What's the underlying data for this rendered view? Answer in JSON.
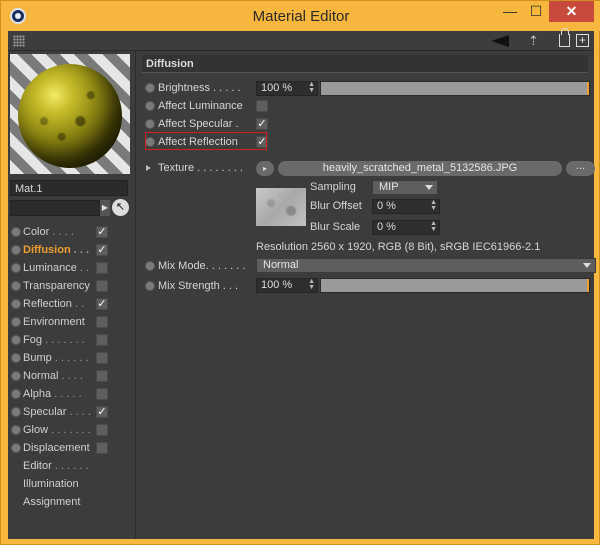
{
  "window": {
    "title": "Material Editor",
    "min_label": "—",
    "max_label": "☐",
    "close_label": "✕"
  },
  "material": {
    "name": "Mat.1"
  },
  "channels": [
    {
      "label": "Color",
      "dots": " . . . .",
      "checked": "✓"
    },
    {
      "label": "Diffusion",
      "dots": " . . .",
      "checked": "✓"
    },
    {
      "label": "Luminance",
      "dots": " . .",
      "checked": ""
    },
    {
      "label": "Transparency",
      "dots": "",
      "checked": ""
    },
    {
      "label": "Reflection",
      "dots": " . .",
      "checked": "✓"
    },
    {
      "label": "Environment",
      "dots": "",
      "checked": ""
    },
    {
      "label": "Fog",
      "dots": " . . . . . . .",
      "checked": ""
    },
    {
      "label": "Bump",
      "dots": " . . . . . .",
      "checked": ""
    },
    {
      "label": "Normal",
      "dots": " . . . .",
      "checked": ""
    },
    {
      "label": "Alpha",
      "dots": " . . . . .",
      "checked": ""
    },
    {
      "label": "Specular",
      "dots": " . . . .",
      "checked": "✓"
    },
    {
      "label": "Glow",
      "dots": " . . . . . . .",
      "checked": ""
    },
    {
      "label": "Displacement",
      "dots": "",
      "checked": ""
    },
    {
      "label": "Editor",
      "dots": " . . . . . .",
      "checked": null
    },
    {
      "label": "Illumination",
      "dots": "",
      "checked": null
    },
    {
      "label": "Assignment",
      "dots": "",
      "checked": null
    }
  ],
  "diffusion": {
    "header": "Diffusion",
    "brightness_label": "Brightness . . . . .",
    "brightness_value": "100 %",
    "brightness_level": 1.0,
    "affect_luminance_label": "Affect Luminance",
    "affect_luminance_checked": "",
    "affect_specular_label": "Affect Specular .",
    "affect_specular_checked": "✓",
    "affect_reflection_label": "Affect Reflection",
    "affect_reflection_checked": "✓",
    "texture_label": "Texture . . . . . . . .",
    "texture_button": "▸",
    "texture_file": "heavily_scratched_metal_5132586.JPG",
    "texture_more": "...",
    "sampling_label": "Sampling",
    "sampling_value": "MIP",
    "blur_offset_label": "Blur Offset",
    "blur_offset_value": "0 %",
    "blur_scale_label": "Blur Scale",
    "blur_scale_value": "0 %",
    "resolution_text": "Resolution 2560 x 1920, RGB (8 Bit), sRGB IEC61966-2.1",
    "mix_mode_label": "Mix Mode. . . . . . .",
    "mix_mode_value": "Normal",
    "mix_strength_label": "Mix Strength . . .",
    "mix_strength_value": "100 %",
    "mix_strength_level": 1.0
  },
  "colors": {
    "accent": "#f0a030",
    "highlight_border": "#d42020"
  }
}
